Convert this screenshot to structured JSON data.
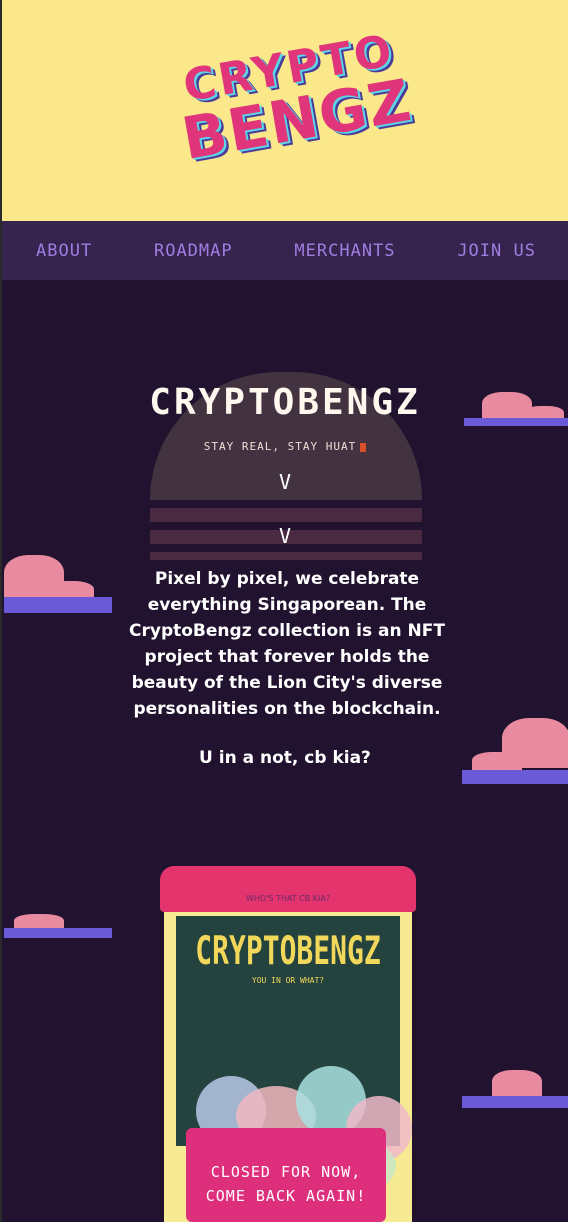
{
  "header": {
    "logo_text_line1": "CRYPTO",
    "logo_text_line2": "BENGZ"
  },
  "nav": {
    "items": [
      {
        "label": "ABOUT"
      },
      {
        "label": "ROADMAP"
      },
      {
        "label": "MERCHANTS"
      },
      {
        "label": "JOIN US"
      }
    ]
  },
  "hero": {
    "title": "CRYPTOBENGZ",
    "tagline": "STAY REAL, STAY HUAT",
    "chevron": "V",
    "description": "Pixel by pixel, we celebrate everything Singaporean. The CryptoBengz collection is an NFT project that forever holds the beauty of the Lion City's diverse personalities on the blockchain.",
    "cta": "U in a not, cb kia?"
  },
  "machine": {
    "top_label": "WHO'S THAT CB KIA?",
    "brand": "CRYPTOBENGZ",
    "subtitle": "YOU IN OR WHAT?",
    "sign_line1": "CLOSED FOR NOW,",
    "sign_line2": "COME BACK AGAIN!"
  },
  "colors": {
    "header_bg": "#fbe88a",
    "nav_bg": "#36244f",
    "nav_text": "#a07de0",
    "page_bg": "#21122f",
    "brand_pink": "#e0357a"
  }
}
